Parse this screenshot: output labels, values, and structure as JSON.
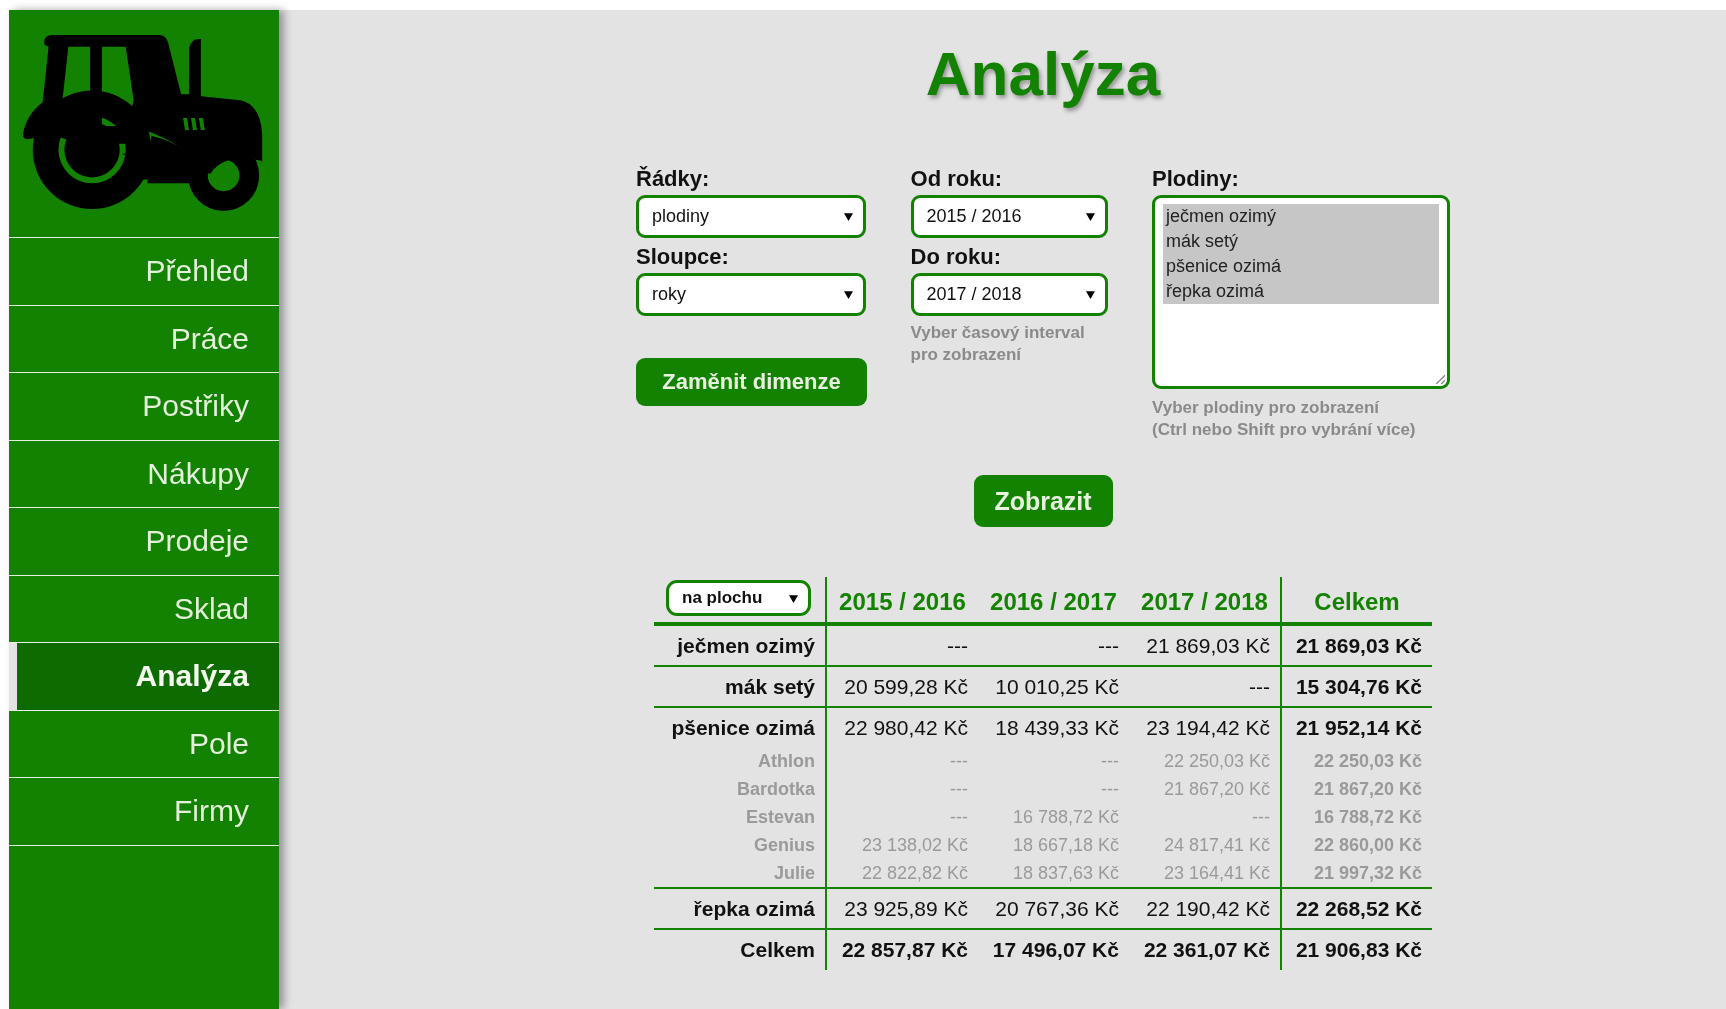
{
  "sidebar": {
    "items": [
      {
        "label": "Přehled",
        "selected": false
      },
      {
        "label": "Práce",
        "selected": false
      },
      {
        "label": "Postřiky",
        "selected": false
      },
      {
        "label": "Nákupy",
        "selected": false
      },
      {
        "label": "Prodeje",
        "selected": false
      },
      {
        "label": "Sklad",
        "selected": false
      },
      {
        "label": "Analýza",
        "selected": true
      },
      {
        "label": "Pole",
        "selected": false
      },
      {
        "label": "Firmy",
        "selected": false
      }
    ]
  },
  "title": "Analýza",
  "form": {
    "rows": {
      "label": "Řádky:",
      "value": "plodiny"
    },
    "columns": {
      "label": "Sloupce:",
      "value": "roky"
    },
    "swap_button": "Zaměnit dimenze",
    "from": {
      "label": "Od roku:",
      "value": "2015 / 2016"
    },
    "to": {
      "label": "Do roku:",
      "value": "2017 / 2018"
    },
    "period_hint": "Vyber časový interval pro zobrazení",
    "crops": {
      "label": "Plodiny:",
      "options": [
        {
          "label": "ječmen ozimý",
          "selected": true
        },
        {
          "label": "mák setý",
          "selected": true
        },
        {
          "label": "pšenice ozimá",
          "selected": true
        },
        {
          "label": "řepka ozimá",
          "selected": true
        }
      ],
      "hint": [
        "Vyber plodiny pro zobrazení",
        "(Ctrl nebo Shift pro vybrání více)"
      ]
    }
  },
  "show_button": "Zobrazit",
  "table": {
    "measure": "na plochu",
    "columns": [
      "2015 / 2016",
      "2016 / 2017",
      "2017 / 2018",
      "Celkem"
    ],
    "rows": [
      {
        "label": "ječmen ozimý",
        "cells": [
          "---",
          "---",
          "21 869,03 Kč",
          "21 869,03 Kč"
        ]
      },
      {
        "label": "mák setý",
        "cells": [
          "20 599,28 Kč",
          "10 010,25 Kč",
          "---",
          "15 304,76 Kč"
        ]
      },
      {
        "label": "pšenice ozimá",
        "cells": [
          "22 980,42 Kč",
          "18 439,33 Kč",
          "23 194,42 Kč",
          "21 952,14 Kč"
        ],
        "children": [
          {
            "label": "Athlon",
            "cells": [
              "---",
              "---",
              "22 250,03 Kč",
              "22 250,03 Kč"
            ]
          },
          {
            "label": "Bardotka",
            "cells": [
              "---",
              "---",
              "21 867,20 Kč",
              "21 867,20 Kč"
            ]
          },
          {
            "label": "Estevan",
            "cells": [
              "---",
              "16 788,72 Kč",
              "---",
              "16 788,72 Kč"
            ]
          },
          {
            "label": "Genius",
            "cells": [
              "23 138,02 Kč",
              "18 667,18 Kč",
              "24 817,41 Kč",
              "22 860,00 Kč"
            ]
          },
          {
            "label": "Julie",
            "cells": [
              "22 822,82 Kč",
              "18 837,63 Kč",
              "23 164,41 Kč",
              "21 997,32 Kč"
            ]
          }
        ]
      },
      {
        "label": "řepka ozimá",
        "cells": [
          "23 925,89 Kč",
          "20 767,36 Kč",
          "22 190,42 Kč",
          "22 268,52 Kč"
        ]
      }
    ],
    "total": {
      "label": "Celkem",
      "cells": [
        "22 857,87 Kč",
        "17 496,07 Kč",
        "22 361,07 Kč",
        "21 906,83 Kč"
      ]
    }
  }
}
